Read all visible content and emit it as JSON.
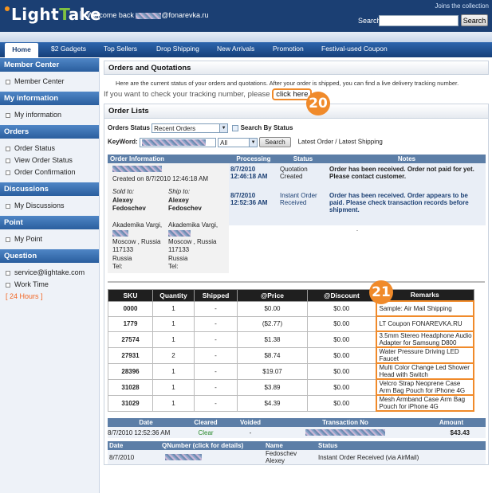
{
  "header": {
    "logo_text_1": "Light",
    "logo_text_2": "ake",
    "logo_letter": "T",
    "welcome_prefix": "Welcome back",
    "welcome_user_suffix": "@fonarevka.ru",
    "joins_link": "Joins the collection",
    "search_label": "Search",
    "search_button": "Search"
  },
  "nav": {
    "items": [
      "Home",
      "$2 Gadgets",
      "Top Sellers",
      "Drop Shipping",
      "New Arrivals",
      "Promotion",
      "Festival-used Coupon"
    ]
  },
  "sidebar": {
    "sections": [
      {
        "title": "Member Center",
        "items": [
          "Member Center"
        ]
      },
      {
        "title": "My information",
        "items": [
          "My information"
        ]
      },
      {
        "title": "Orders",
        "items": [
          "Order Status",
          "View Order Status",
          "Order Confirmation"
        ]
      },
      {
        "title": "Discussions",
        "items": [
          "My Discussions"
        ]
      },
      {
        "title": "Point",
        "items": [
          "My Point"
        ]
      },
      {
        "title": "Question",
        "items": [
          "service@lightake.com",
          "Work Time"
        ]
      }
    ],
    "hours_note": "[ 24 Hours ]"
  },
  "orders_quotations": {
    "title": "Orders and Quotations",
    "intro": "Here are the current status of your orders and quotations. After your order is shipped, you can find a live delivery tracking number.",
    "track_text": "If you want to check your tracking number, please",
    "track_link": "click here",
    "badge_20": "20"
  },
  "order_lists": {
    "title": "Order Lists",
    "status_label": "Orders Status",
    "status_value": "Recent Orders",
    "search_by_status": "Search By Status",
    "keyword_label": "KeyWord:",
    "keyword_scope": "All",
    "search_button": "Search",
    "latest_label": "Latest Order / Latest Shipping"
  },
  "order_info": {
    "headers": [
      "Order Information",
      "Processing",
      "Status",
      "Notes"
    ],
    "created": "Created on 8/7/2010 12:46:18 AM",
    "sold_to_label": "Sold to:",
    "ship_to_label": "Ship to:",
    "name_first": "Alexey",
    "name_last": "Fedoschev",
    "address_line_1": "Akademika Vargi,",
    "city": "Moscow , Russia",
    "zip": "117133",
    "country": "Russia",
    "tel": "Tel:",
    "rows": [
      {
        "processing_date": "8/7/2010",
        "processing_time": "12:46:18 AM",
        "status_1": "Quotation",
        "status_2": "Created",
        "note": "Order has been received. Order not paid for yet. Please contact customer."
      },
      {
        "processing_date": "8/7/2010",
        "processing_time": "12:52:36 AM",
        "status_1": "Instant Order",
        "status_2": "Received",
        "note": "Order has been received. Order appears to be paid. Please check transaction records before shipment."
      }
    ],
    "dot": "."
  },
  "items": {
    "headers": [
      "SKU",
      "Quantity",
      "Shipped",
      "@Price",
      "@Discount",
      "Remarks"
    ],
    "badge_21": "21",
    "rows": [
      {
        "sku": "0000",
        "qty": "1",
        "shipped": "-",
        "price": "$0.00",
        "discount": "$0.00",
        "remarks": "Sample: Air Mail Shipping"
      },
      {
        "sku": "1779",
        "qty": "1",
        "shipped": "-",
        "price": "($2.77)",
        "discount": "$0.00",
        "remarks": "LT Coupon FONAREVKA.RU"
      },
      {
        "sku": "27574",
        "qty": "1",
        "shipped": "-",
        "price": "$1.38",
        "discount": "$0.00",
        "remarks": "3.5mm Stereo Headphone Audio Adapter for Samsung D800"
      },
      {
        "sku": "27931",
        "qty": "2",
        "shipped": "-",
        "price": "$8.74",
        "discount": "$0.00",
        "remarks": "Water Pressure Driving LED Faucet"
      },
      {
        "sku": "28396",
        "qty": "1",
        "shipped": "-",
        "price": "$19.07",
        "discount": "$0.00",
        "remarks": "Multi Color Change Led Shower Head with Switch"
      },
      {
        "sku": "31028",
        "qty": "1",
        "shipped": "-",
        "price": "$3.89",
        "discount": "$0.00",
        "remarks": "Velcro Strap Neoprene Case Arm Bag Pouch for iPhone 4G"
      },
      {
        "sku": "31029",
        "qty": "1",
        "shipped": "-",
        "price": "$4.39",
        "discount": "$0.00",
        "remarks": "Mesh Armband Case Arm Bag Pouch for iPhone 4G"
      }
    ]
  },
  "transactions": {
    "headers": [
      "Date",
      "Cleared",
      "Voided",
      "Transaction No",
      "Amount"
    ],
    "row": {
      "date": "8/7/2010 12:52:36 AM",
      "cleared": "Clear",
      "voided": "-",
      "amount": "$43.43"
    }
  },
  "qnumbers": {
    "headers": [
      "Date",
      "QNumber (click for details)",
      "Name",
      "Status"
    ],
    "row": {
      "date": "8/7/2010",
      "name_1": "Fedoschev",
      "name_2": "Alexey",
      "status": "Instant Order Received (via AirMail)"
    }
  },
  "colors": {
    "accent": "#f08a2a",
    "nav": "#1b3f73",
    "header_row": "#5c7ea7"
  }
}
